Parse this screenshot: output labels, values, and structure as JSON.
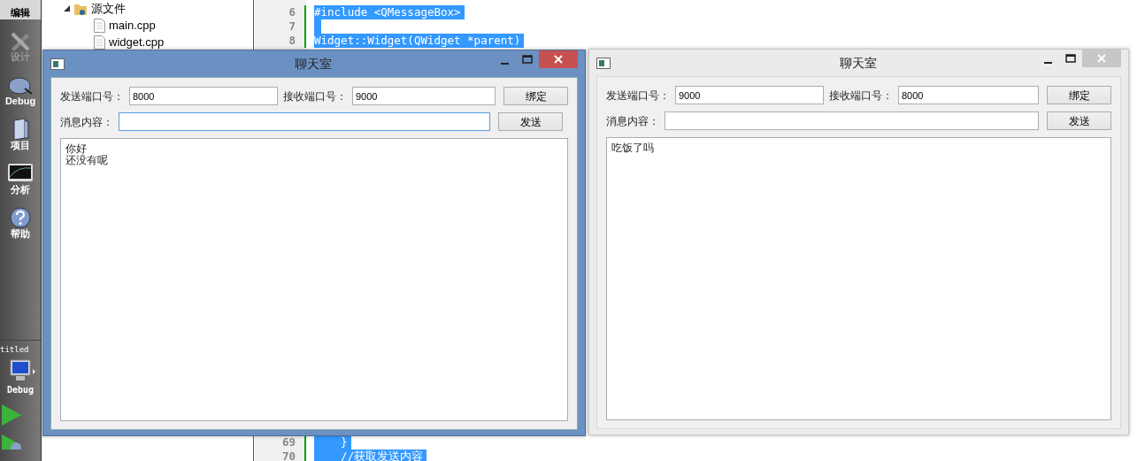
{
  "ide": {
    "sidebar": [
      {
        "kind": "edit",
        "label": "编辑",
        "selected": true,
        "disabled": false
      },
      {
        "kind": "design",
        "label": "设计",
        "selected": false,
        "disabled": true
      },
      {
        "kind": "debug",
        "label": "Debug",
        "selected": false,
        "disabled": false
      },
      {
        "kind": "project",
        "label": "项目",
        "selected": false,
        "disabled": false
      },
      {
        "kind": "analyze",
        "label": "分析",
        "selected": false,
        "disabled": false
      },
      {
        "kind": "help",
        "label": "帮助",
        "selected": false,
        "disabled": false
      }
    ],
    "target": {
      "project": "titled",
      "build": "Debug"
    },
    "tree": {
      "folder": "源文件",
      "files": [
        "main.cpp",
        "widget.cpp"
      ]
    },
    "code_top": [
      {
        "number": "6",
        "text": "#include <QMessageBox>"
      },
      {
        "number": "7"
      },
      {
        "number": "8",
        "text": "Widget::Widget(QWidget *parent)"
      }
    ],
    "code_bottom": [
      {
        "number": "69",
        "text": "    }"
      },
      {
        "number": "70",
        "text": "    //获取发送内容"
      }
    ]
  },
  "windows": [
    {
      "title": "聊天室",
      "active": true,
      "send_port_label": "发送端口号：",
      "send_port": "8000",
      "recv_port_label": "接收端口号：",
      "recv_port": "9000",
      "bind_button": "绑定",
      "message_label": "消息内容：",
      "message_focused": true,
      "send_button": "发送",
      "log": [
        "你好",
        "还没有呢"
      ]
    },
    {
      "title": "聊天室",
      "active": false,
      "send_port_label": "发送端口号：",
      "send_port": "9000",
      "recv_port_label": "接收端口号：",
      "recv_port": "8000",
      "bind_button": "绑定",
      "message_label": "消息内容：",
      "message_focused": false,
      "send_button": "发送",
      "log": [
        "吃饭了吗"
      ]
    }
  ]
}
